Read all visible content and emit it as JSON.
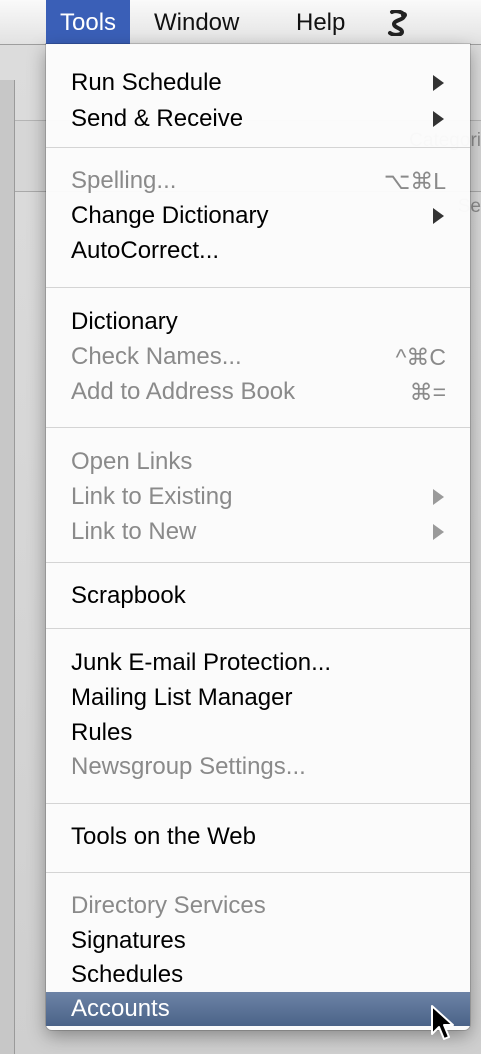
{
  "menubar": {
    "tools": "Tools",
    "window": "Window",
    "help": "Help",
    "script_icon": "script-icon"
  },
  "background": {
    "categories_fragment": "Categori",
    "search_fragment": "Se"
  },
  "menu": {
    "items": [
      {
        "label": "Run Schedule",
        "submenu": true,
        "enabled": true
      },
      {
        "label": "Send & Receive",
        "submenu": true,
        "enabled": true
      },
      {
        "label": "Spelling...",
        "shortcut": "⌥⌘L",
        "enabled": false
      },
      {
        "label": "Change Dictionary",
        "submenu": true,
        "enabled": true
      },
      {
        "label": "AutoCorrect...",
        "enabled": true
      },
      {
        "label": "Dictionary",
        "enabled": true
      },
      {
        "label": "Check Names...",
        "shortcut": "^⌘C",
        "enabled": false
      },
      {
        "label": "Add to Address Book",
        "shortcut": "⌘=",
        "enabled": false
      },
      {
        "label": "Open Links",
        "enabled": false
      },
      {
        "label": "Link to Existing",
        "submenu": true,
        "enabled": false
      },
      {
        "label": "Link to New",
        "submenu": true,
        "enabled": false
      },
      {
        "label": "Scrapbook",
        "enabled": true
      },
      {
        "label": "Junk E-mail Protection...",
        "enabled": true
      },
      {
        "label": "Mailing List Manager",
        "enabled": true
      },
      {
        "label": "Rules",
        "enabled": true
      },
      {
        "label": "Newsgroup Settings...",
        "enabled": false
      },
      {
        "label": "Tools on the Web",
        "enabled": true
      },
      {
        "label": "Directory Services",
        "enabled": false
      },
      {
        "label": "Signatures",
        "enabled": true
      },
      {
        "label": "Schedules",
        "enabled": true
      },
      {
        "label": "Accounts",
        "enabled": true,
        "highlighted": true
      }
    ]
  },
  "colors": {
    "menu_selected": "#3a5fb7",
    "highlight": "#566e93",
    "disabled_text": "#8a8a8a"
  }
}
